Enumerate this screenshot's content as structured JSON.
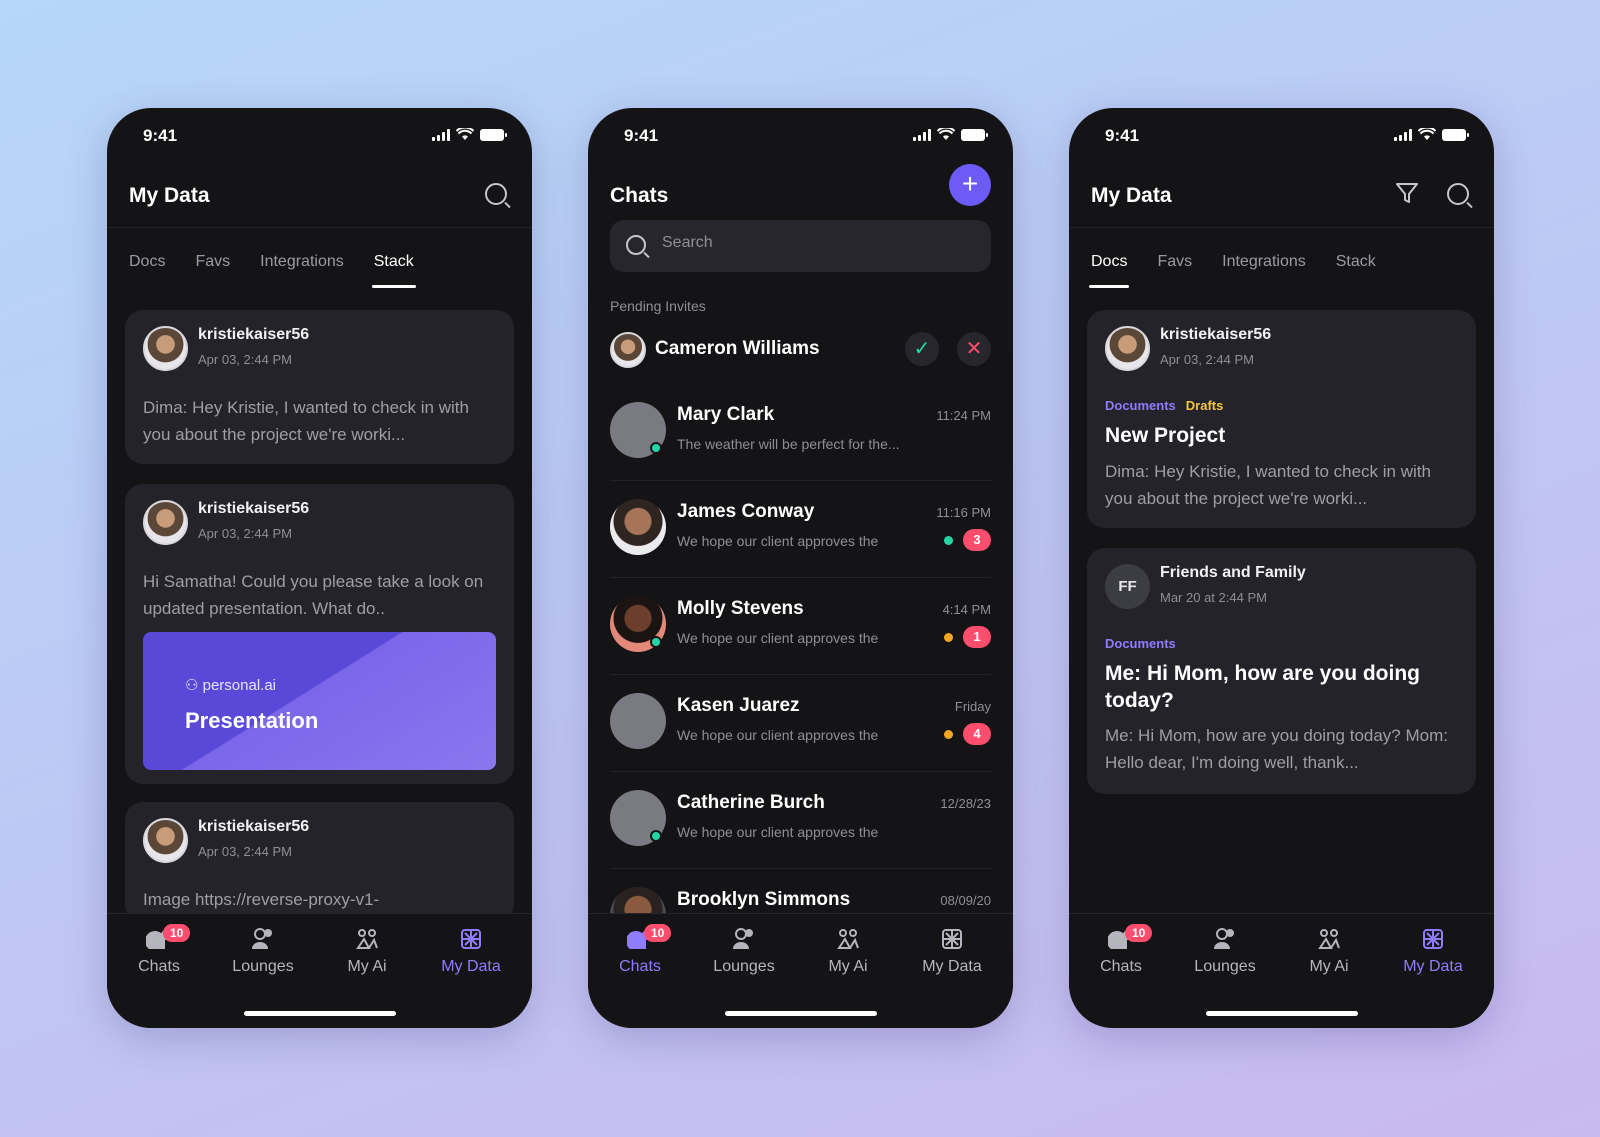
{
  "status": {
    "time": "9:41"
  },
  "nav": {
    "chats": "Chats",
    "chats_badge": "10",
    "lounges": "Lounges",
    "myai": "My Ai",
    "mydata": "My Data"
  },
  "screen1": {
    "title": "My Data",
    "tabs": [
      "Docs",
      "Favs",
      "Integrations",
      "Stack"
    ],
    "cards": [
      {
        "user": "kristiekaiser56",
        "date": "Apr 03, 2:44 PM",
        "body": "Dima: Hey Kristie, I wanted to check in with you about the project we're worki..."
      },
      {
        "user": "kristiekaiser56",
        "date": "Apr 03, 2:44 PM",
        "body": "Hi Samatha! Could you please take a look on updated presentation. What do..",
        "promo_brand": "personal.ai",
        "promo_title": "Presentation"
      },
      {
        "user": "kristiekaiser56",
        "date": "Apr 03, 2:44 PM",
        "body": "Image https://reverse-proxy-v1-"
      }
    ]
  },
  "screen2": {
    "title": "Chats",
    "add_label": "+",
    "search_placeholder": "Search",
    "pending_label": "Pending Invites",
    "invite": {
      "name": "Cameron Williams",
      "accept": "✓",
      "decline": "✕"
    },
    "chats": [
      {
        "name": "Mary Clark",
        "preview": "The weather will be perfect for the...",
        "time": "11:24 PM",
        "badge": ""
      },
      {
        "name": "James Conway",
        "preview": "We hope our client approves the",
        "time": "11:16 PM",
        "badge": "3"
      },
      {
        "name": "Molly Stevens",
        "preview": "We hope our client approves the",
        "time": "4:14 PM",
        "badge": "1"
      },
      {
        "name": "Kasen Juarez",
        "preview": "We hope our client approves the",
        "time": "Friday",
        "badge": "4"
      },
      {
        "name": "Catherine Burch",
        "preview": "We hope our client approves the",
        "time": "12/28/23",
        "badge": ""
      },
      {
        "name": "Brooklyn Simmons",
        "preview": "",
        "time": "08/09/20",
        "badge": ""
      }
    ]
  },
  "screen3": {
    "title": "My Data",
    "tabs": [
      "Docs",
      "Favs",
      "Integrations",
      "Stack"
    ],
    "card1": {
      "user": "kristiekaiser56",
      "date": "Apr 03, 2:44 PM",
      "tag1": "Documents",
      "tag2": "Drafts",
      "title": "New Project",
      "body": "Dima: Hey Kristie, I wanted to check in with you about the project we're worki..."
    },
    "card2": {
      "initials": "FF",
      "user": "Friends and Family",
      "date": "Mar 20 at 2:44 PM",
      "tag1": "Documents",
      "title": "Me: Hi Mom, how are you doing today?",
      "body": "Me: Hi Mom, how are you doing today? Mom: Hello dear, I'm doing well, thank..."
    }
  },
  "colors": {
    "accent": "#6c5bf5",
    "badge": "#ff4d6d",
    "online": "#24d6a6",
    "tag_docs": "#8f7cff",
    "tag_drafts": "#f5c542"
  }
}
